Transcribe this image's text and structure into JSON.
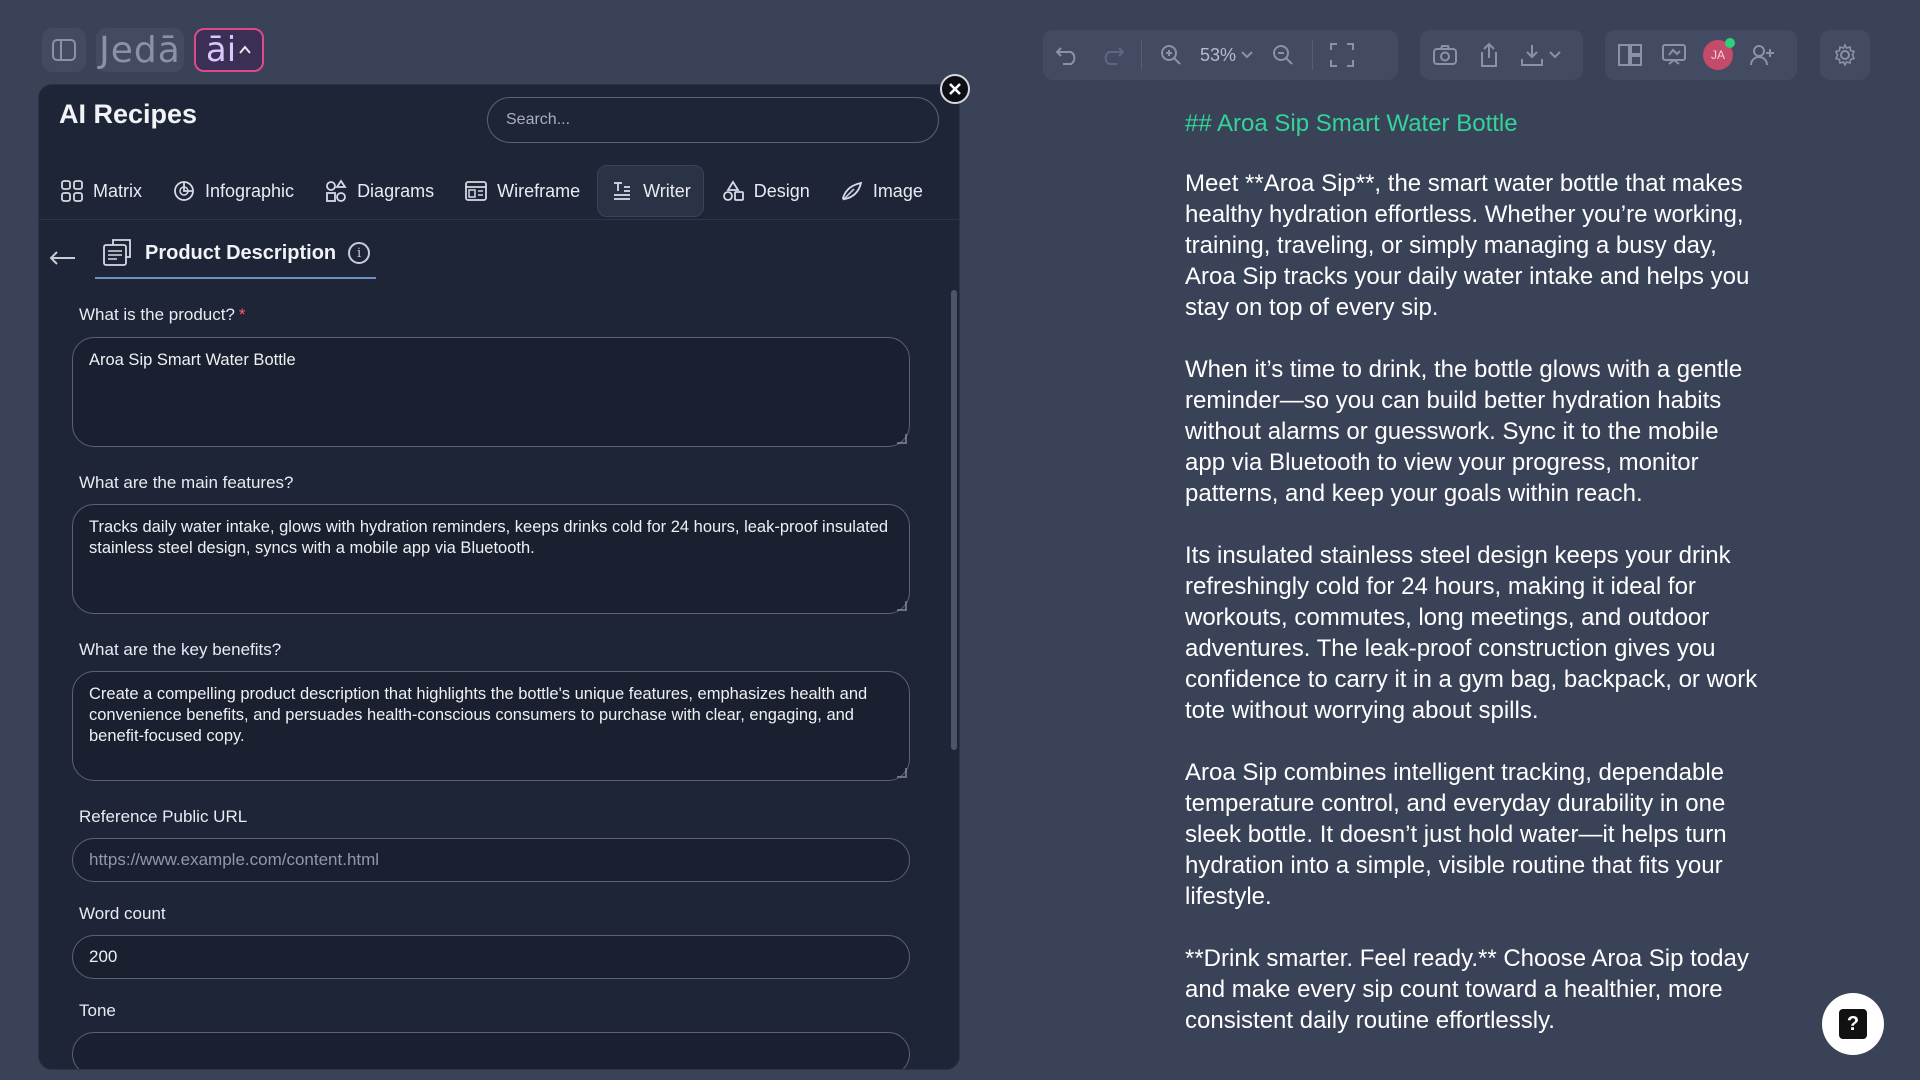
{
  "app": {
    "logo_text": "Jedā",
    "ai_button_label": "āi"
  },
  "toolbar": {
    "zoom_level": "53%",
    "avatar_initials": "JA"
  },
  "panel": {
    "title": "AI Recipes",
    "search_placeholder": "Search...",
    "tabs": [
      {
        "label": "Matrix",
        "icon": "matrix-icon"
      },
      {
        "label": "Infographic",
        "icon": "infographic-icon"
      },
      {
        "label": "Diagrams",
        "icon": "diagrams-icon"
      },
      {
        "label": "Wireframe",
        "icon": "wireframe-icon"
      },
      {
        "label": "Writer",
        "icon": "writer-icon",
        "active": true
      },
      {
        "label": "Design",
        "icon": "design-icon"
      },
      {
        "label": "Image",
        "icon": "image-icon"
      }
    ],
    "recipe_title": "Product Description",
    "fields": {
      "product_label": "What is the product?",
      "product_required": "*",
      "product_value": "Aroa Sip Smart Water Bottle",
      "features_label": "What are the main features?",
      "features_value": "Tracks daily water intake, glows with hydration reminders, keeps drinks cold for 24 hours, leak-proof insulated stainless steel design, syncs with a mobile app via Bluetooth.",
      "benefits_label": "What are the key benefits?",
      "benefits_value": "Create a compelling product description that highlights the bottle's unique features, emphasizes health and convenience benefits, and persuades health-conscious consumers to purchase with clear, engaging, and benefit-focused copy.",
      "url_label": "Reference Public URL",
      "url_placeholder": "https://www.example.com/content.html",
      "wordcount_label": "Word count",
      "wordcount_value": "200",
      "tone_label": "Tone"
    }
  },
  "preview": {
    "heading": "## Aroa Sip Smart Water Bottle",
    "paragraphs": [
      "Meet **Aroa Sip**, the smart water bottle that makes healthy hydration effortless. Whether you’re working, training, traveling, or simply managing a busy day, Aroa Sip tracks your daily water intake and helps you stay on top of every sip.",
      "When it’s time to drink, the bottle glows with a gentle reminder—so you can build better hydration habits without alarms or guesswork. Sync it to the mobile app via Bluetooth to view your progress, monitor patterns, and keep your goals within reach.",
      "Its insulated stainless steel design keeps your drink refreshingly cold for 24 hours, making it ideal for workouts, commutes, long meetings, and outdoor adventures. The leak-proof construction gives you confidence to carry it in a gym bag, backpack, or work tote without worrying about spills.",
      "Aroa Sip combines intelligent tracking, dependable temperature control, and everyday durability in one sleek bottle. It doesn’t just hold water—it helps turn hydration into a simple, visible routine that fits your lifestyle.",
      "**Drink smarter. Feel ready.** Choose Aroa Sip today and make every sip count toward a healthier, more consistent daily routine effortlessly."
    ]
  },
  "colors": {
    "background": "#3a4258",
    "panel": "#1e2536",
    "heading_green": "#34d399",
    "ai_border": "#e0488c"
  }
}
